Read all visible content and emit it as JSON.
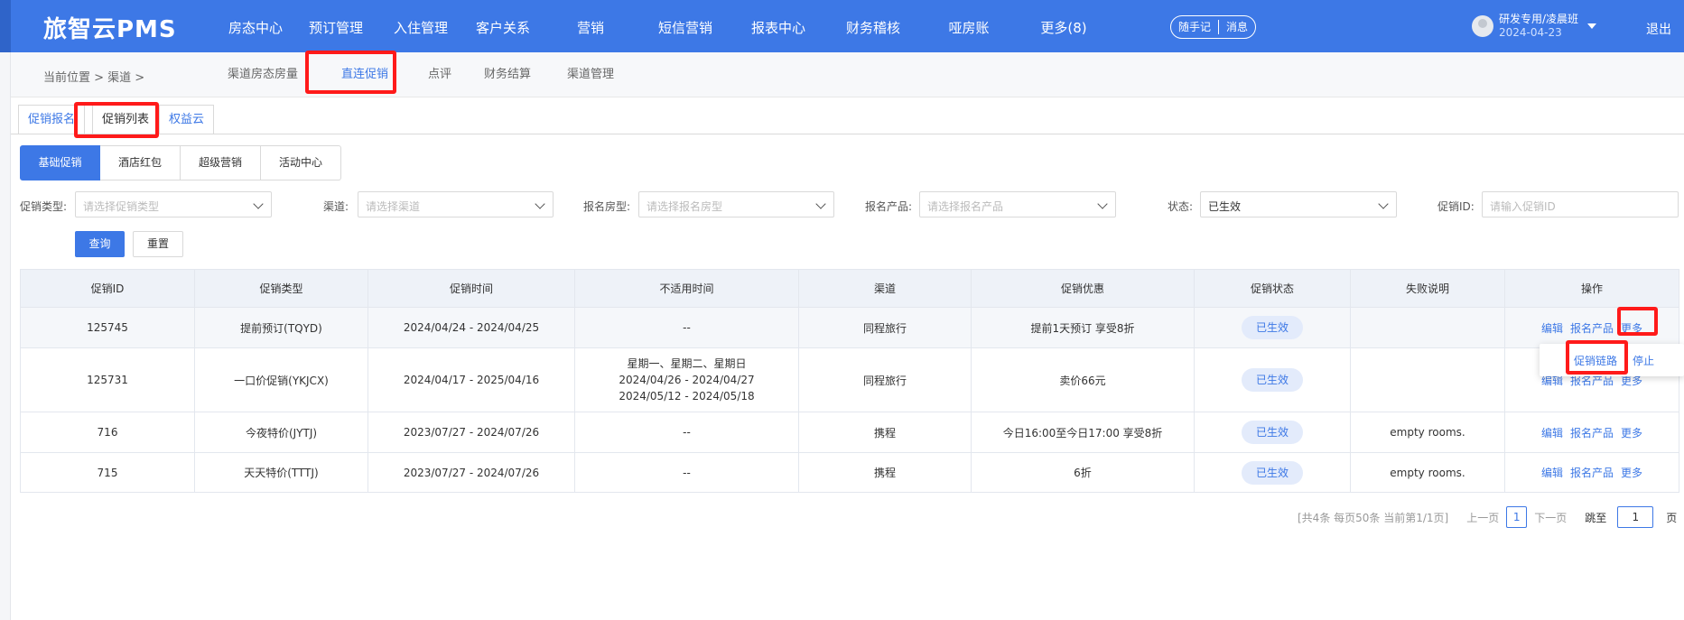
{
  "header": {
    "logo": "旅智云PMS",
    "nav": [
      "房态中心",
      "预订管理",
      "入住管理",
      "客户关系",
      "营销",
      "短信营销",
      "报表中心",
      "财务稽核",
      "哑房账",
      "更多(8)"
    ],
    "pill_note": "随手记",
    "pill_msg": "消息",
    "user_name": "研发专用/凌晨班",
    "user_date": "2024-04-23",
    "logout": "退出"
  },
  "crumb": {
    "text": "当前位置 > 渠道 >",
    "subnav": [
      "渠道房态房量",
      "直连促销",
      "点评",
      "财务结算",
      "渠道管理"
    ]
  },
  "tabs": [
    "促销报名",
    "促销列表",
    "权益云"
  ],
  "segments": [
    "基础促销",
    "酒店红包",
    "超级营销",
    "活动中心"
  ],
  "filters": {
    "type_label": "促销类型:",
    "type_placeholder": "请选择促销类型",
    "channel_label": "渠道:",
    "channel_placeholder": "请选择渠道",
    "room_label": "报名房型:",
    "room_placeholder": "请选择报名房型",
    "product_label": "报名产品:",
    "product_placeholder": "请选择报名产品",
    "status_label": "状态:",
    "status_value": "已生效",
    "id_label": "促销ID:",
    "id_placeholder": "请输入促销ID",
    "query_btn": "查询",
    "reset_btn": "重置"
  },
  "table": {
    "headers": [
      "促销ID",
      "促销类型",
      "促销时间",
      "不适用时间",
      "渠道",
      "促销优惠",
      "促销状态",
      "失败说明",
      "操作"
    ],
    "rows": [
      {
        "id": "125745",
        "type": "提前预订(TQYD)",
        "time": "2024/04/24 - 2024/04/25",
        "na1": "--",
        "na2": "",
        "na3": "",
        "channel": "同程旅行",
        "discount": "提前1天预订 享受8折",
        "status": "已生效",
        "fail": ""
      },
      {
        "id": "125731",
        "type": "一口价促销(YKJCX)",
        "time": "2024/04/17 - 2025/04/16",
        "na1": "星期一、星期二、星期日",
        "na2": "2024/04/26 - 2024/04/27",
        "na3": "2024/05/12 - 2024/05/18",
        "channel": "同程旅行",
        "discount": "卖价66元",
        "status": "已生效",
        "fail": ""
      },
      {
        "id": "716",
        "type": "今夜特价(JYTJ)",
        "time": "2023/07/27 - 2024/07/26",
        "na1": "--",
        "na2": "",
        "na3": "",
        "channel": "携程",
        "discount": "今日16:00至今日17:00 享受8折",
        "status": "已生效",
        "fail": "empty rooms."
      },
      {
        "id": "715",
        "type": "天天特价(TTTJ)",
        "time": "2023/07/27 - 2024/07/26",
        "na1": "--",
        "na2": "",
        "na3": "",
        "channel": "携程",
        "discount": "6折",
        "status": "已生效",
        "fail": "empty rooms."
      }
    ],
    "op_edit": "编辑",
    "op_product": "报名产品",
    "op_more": "更多"
  },
  "dropdown": {
    "link": "促销链路",
    "stop": "停止"
  },
  "pager": {
    "summary": "[共4条 每页50条 当前第1/1页]",
    "prev": "上一页",
    "current": "1",
    "next": "下一页",
    "goto": "跳至",
    "goto_value": "1",
    "page": "页"
  },
  "colors": {
    "primary": "#3d78e6",
    "highlight": "#ff1a1a"
  }
}
